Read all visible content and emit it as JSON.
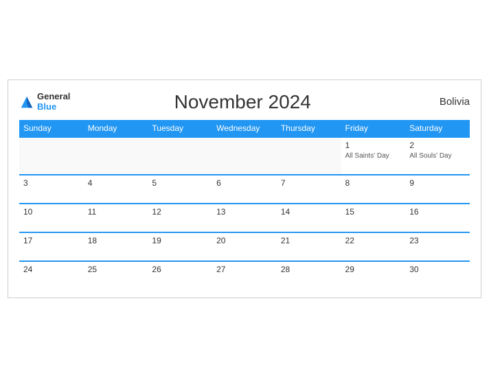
{
  "header": {
    "logo_general": "General",
    "logo_blue": "Blue",
    "title": "November 2024",
    "country": "Bolivia"
  },
  "days_of_week": [
    "Sunday",
    "Monday",
    "Tuesday",
    "Wednesday",
    "Thursday",
    "Friday",
    "Saturday"
  ],
  "weeks": [
    [
      {
        "day": "",
        "empty": true
      },
      {
        "day": "",
        "empty": true
      },
      {
        "day": "",
        "empty": true
      },
      {
        "day": "",
        "empty": true
      },
      {
        "day": "",
        "empty": true
      },
      {
        "day": "1",
        "holiday": "All Saints' Day"
      },
      {
        "day": "2",
        "holiday": "All Souls' Day"
      }
    ],
    [
      {
        "day": "3",
        "holiday": ""
      },
      {
        "day": "4",
        "holiday": ""
      },
      {
        "day": "5",
        "holiday": ""
      },
      {
        "day": "6",
        "holiday": ""
      },
      {
        "day": "7",
        "holiday": ""
      },
      {
        "day": "8",
        "holiday": ""
      },
      {
        "day": "9",
        "holiday": ""
      }
    ],
    [
      {
        "day": "10",
        "holiday": ""
      },
      {
        "day": "11",
        "holiday": ""
      },
      {
        "day": "12",
        "holiday": ""
      },
      {
        "day": "13",
        "holiday": ""
      },
      {
        "day": "14",
        "holiday": ""
      },
      {
        "day": "15",
        "holiday": ""
      },
      {
        "day": "16",
        "holiday": ""
      }
    ],
    [
      {
        "day": "17",
        "holiday": ""
      },
      {
        "day": "18",
        "holiday": ""
      },
      {
        "day": "19",
        "holiday": ""
      },
      {
        "day": "20",
        "holiday": ""
      },
      {
        "day": "21",
        "holiday": ""
      },
      {
        "day": "22",
        "holiday": ""
      },
      {
        "day": "23",
        "holiday": ""
      }
    ],
    [
      {
        "day": "24",
        "holiday": ""
      },
      {
        "day": "25",
        "holiday": ""
      },
      {
        "day": "26",
        "holiday": ""
      },
      {
        "day": "27",
        "holiday": ""
      },
      {
        "day": "28",
        "holiday": ""
      },
      {
        "day": "29",
        "holiday": ""
      },
      {
        "day": "30",
        "holiday": ""
      }
    ]
  ]
}
